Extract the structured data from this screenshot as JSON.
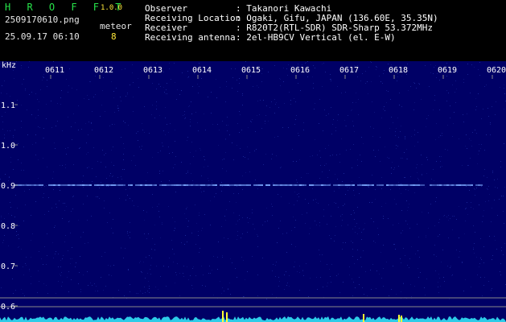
{
  "header": {
    "app_name": "H R O F F T",
    "version": "1.0.0",
    "filename": "2509170610.png",
    "meteor_label": "meteor",
    "meteor_count": "8",
    "datetime": "25.09.17 06:10"
  },
  "info": {
    "observer_label": "Observer",
    "observer_value": ": Takanori Kawachi",
    "location_label": "Receiving Location",
    "location_value": ": Ogaki, Gifu, JAPAN (136.60E, 35.35N)",
    "receiver_label": "Receiver",
    "receiver_value": ": R820T2(RTL-SDR) SDR-Sharp 53.372MHz",
    "antenna_label": "Receiving antenna",
    "antenna_value": ": 2el-HB9CV Vertical (el. E-W)"
  },
  "chart_data": {
    "type": "heatmap",
    "y_unit_label": "kHz",
    "x_tick_labels": [
      "0611",
      "0612",
      "0613",
      "0614",
      "0615",
      "0616",
      "0617",
      "0618",
      "0619",
      "0620"
    ],
    "y_tick_labels": [
      "1.1",
      "1.0",
      "0.9",
      "0.8",
      "0.7",
      "0.6"
    ],
    "y_ticks": [
      1.1,
      1.0,
      0.9,
      0.8,
      0.7,
      0.6
    ],
    "ylim": [
      0.58,
      1.19
    ],
    "carrier_khz": 0.9,
    "colors": {
      "background": "#000066",
      "noise": "#2233aa",
      "carrier": "#7aa8ff",
      "level": "#35f0ff",
      "peak": "#ffff33",
      "grid": "#8a8a8a",
      "labels": "#ffffff"
    }
  }
}
